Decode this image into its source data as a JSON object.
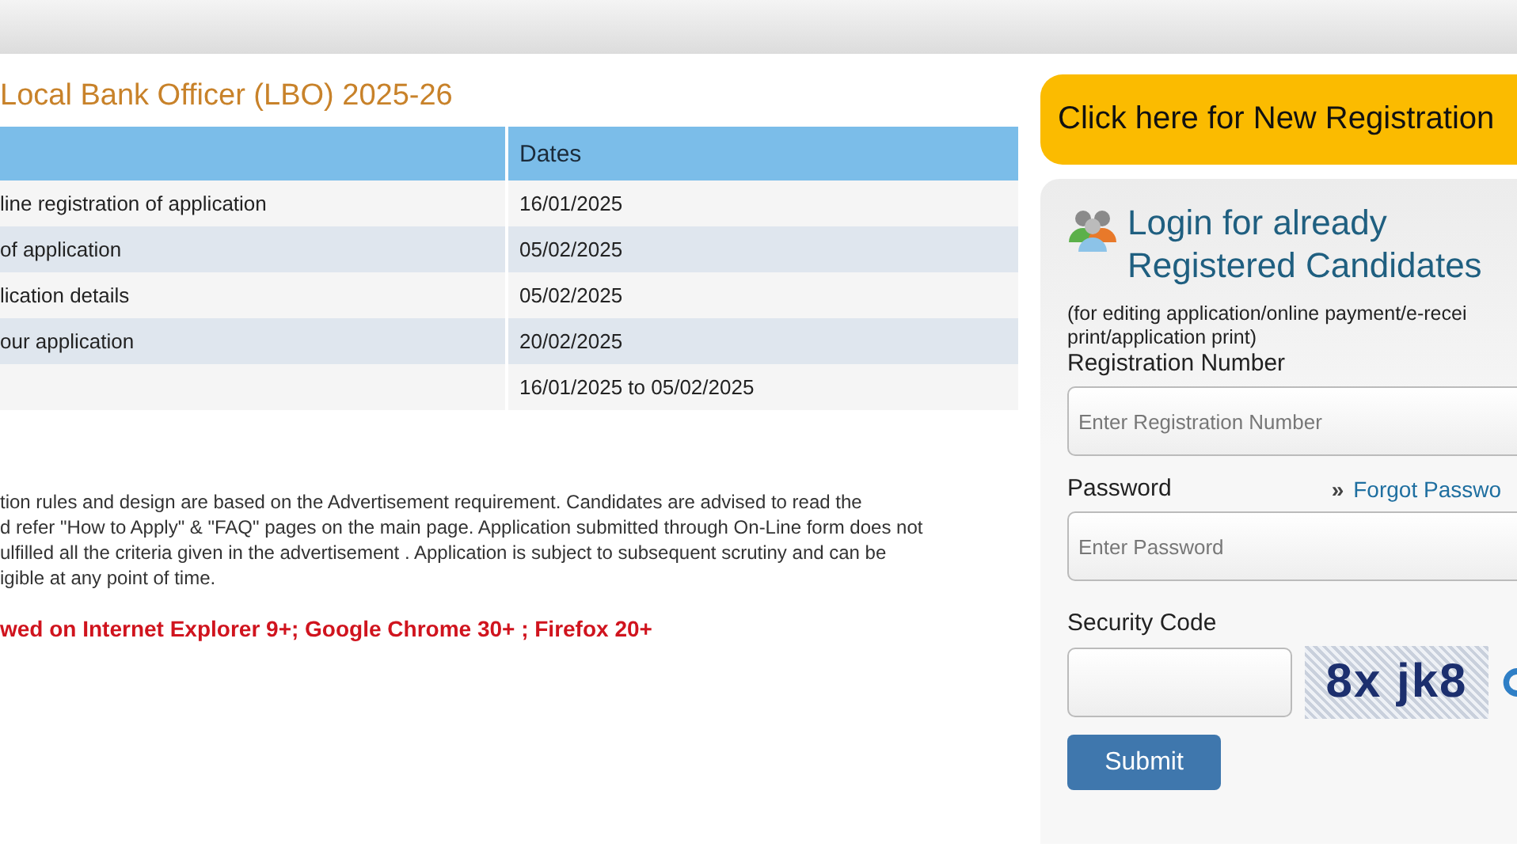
{
  "title": "Local Bank Officer (LBO) 2025-26",
  "table": {
    "columns": [
      "",
      "Dates"
    ],
    "rows": [
      [
        "line registration of application",
        "16/01/2025"
      ],
      [
        "of application",
        "05/02/2025"
      ],
      [
        "lication details",
        "05/02/2025"
      ],
      [
        "our application",
        "20/02/2025"
      ],
      [
        "",
        "16/01/2025 to 05/02/2025"
      ]
    ]
  },
  "notes": [
    "tion rules and design are based on the Advertisement requirement. Candidates are advised to read the",
    "d refer \"How to Apply\" & \"FAQ\" pages on the main page. Application submitted through On-Line form does not",
    "ulfilled all the criteria given in the advertisement . Application is subject to subsequent scrutiny and can be",
    "igible at any point of time."
  ],
  "browser_note": "wed on Internet Explorer 9+; Google Chrome 30+ ; Firefox 20+",
  "new_registration_button": "Click here for New Registration",
  "login": {
    "heading": [
      "Login for already",
      "Registered Candidates"
    ],
    "subtitle": [
      "(for editing application/online payment/e-recei",
      "print/application print)"
    ],
    "registration_label": "Registration Number",
    "registration_placeholder": "Enter Registration Number",
    "password_label": "Password",
    "forgot_link": "Forgot Passwo",
    "forgot_icon": "»",
    "password_placeholder": "Enter Password",
    "security_label": "Security Code",
    "captcha": "8x jk8",
    "submit": "Submit"
  }
}
